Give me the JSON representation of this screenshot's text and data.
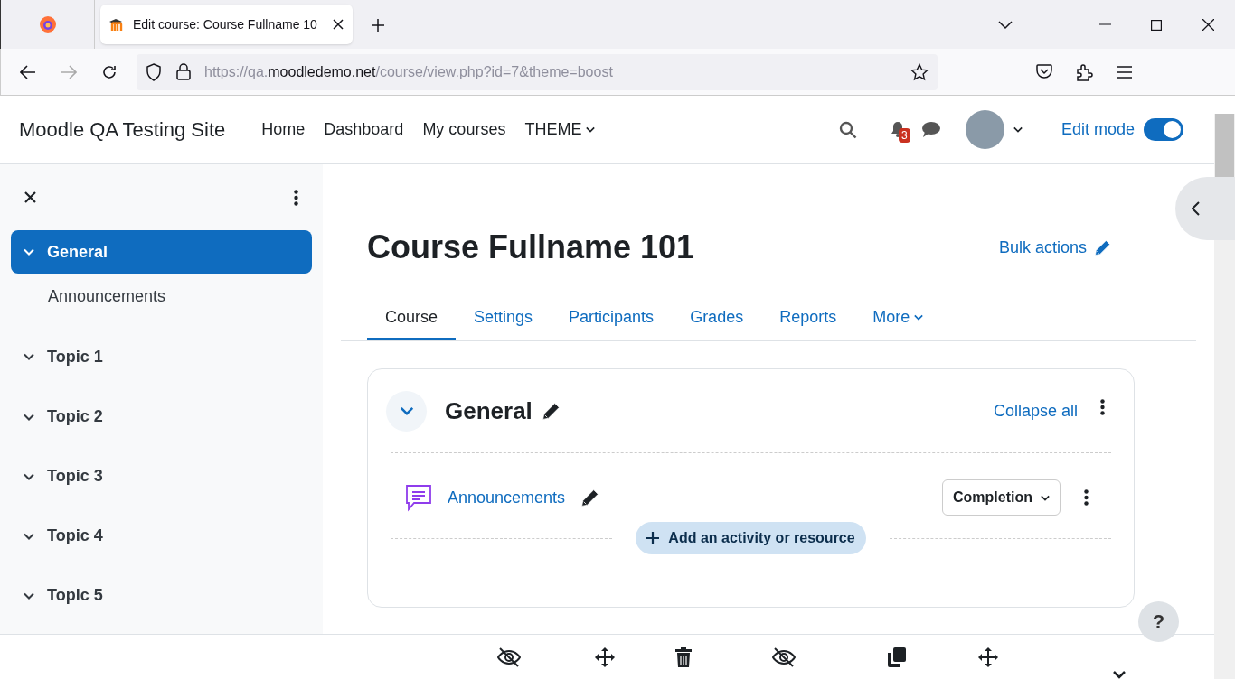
{
  "browser": {
    "tab_title": "Edit course: Course Fullname 10",
    "url_scheme": "https://qa.",
    "url_host": "moodledemo.net",
    "url_path": "/course/view.php?id=7&theme=boost"
  },
  "navbar": {
    "site_name": "Moodle QA Testing Site",
    "links": [
      {
        "label": "Home",
        "kind": "link"
      },
      {
        "label": "Dashboard",
        "kind": "link"
      },
      {
        "label": "My courses",
        "kind": "link"
      },
      {
        "label": "THEME",
        "kind": "dropdown"
      }
    ],
    "notification_count": "3",
    "edit_mode": {
      "label": "Edit mode",
      "on": true
    }
  },
  "sidebar": {
    "items": [
      {
        "label": "General",
        "selected": true,
        "children": [
          {
            "label": "Announcements",
            "selected": false
          }
        ]
      },
      {
        "label": "Topic 1",
        "selected": false
      },
      {
        "label": "Topic 2",
        "selected": false
      },
      {
        "label": "Topic 3",
        "selected": false
      },
      {
        "label": "Topic 4",
        "selected": false
      },
      {
        "label": "Topic 5",
        "selected": false
      }
    ]
  },
  "course": {
    "title": "Course Fullname 101",
    "bulk_actions": "Bulk actions",
    "tabs": [
      {
        "label": "Course",
        "selected": true,
        "kind": "link"
      },
      {
        "label": "Settings",
        "selected": false,
        "kind": "link"
      },
      {
        "label": "Participants",
        "selected": false,
        "kind": "link"
      },
      {
        "label": "Grades",
        "selected": false,
        "kind": "link"
      },
      {
        "label": "Reports",
        "selected": false,
        "kind": "link"
      },
      {
        "label": "More",
        "selected": false,
        "kind": "dropdown"
      }
    ],
    "section": {
      "title": "General",
      "collapse_all": "Collapse all",
      "activities": [
        {
          "name": "Announcements",
          "completion": "Completion"
        }
      ],
      "add_button": "Add an activity or resource"
    }
  },
  "help_label": "?"
}
